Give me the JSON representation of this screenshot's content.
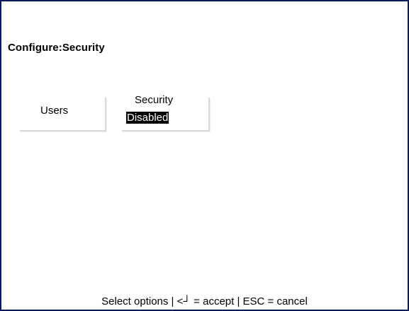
{
  "screen": {
    "title": "Configure:Security"
  },
  "options": {
    "users_label": "Users",
    "security_label": "Security",
    "security_value": "Disabled"
  },
  "footer": {
    "hint": "Select options | <┘ = accept | ESC = cancel"
  },
  "colors": {
    "border": "#0a1a5c",
    "selection_bg": "#000000",
    "selection_fg": "#ffffff"
  }
}
